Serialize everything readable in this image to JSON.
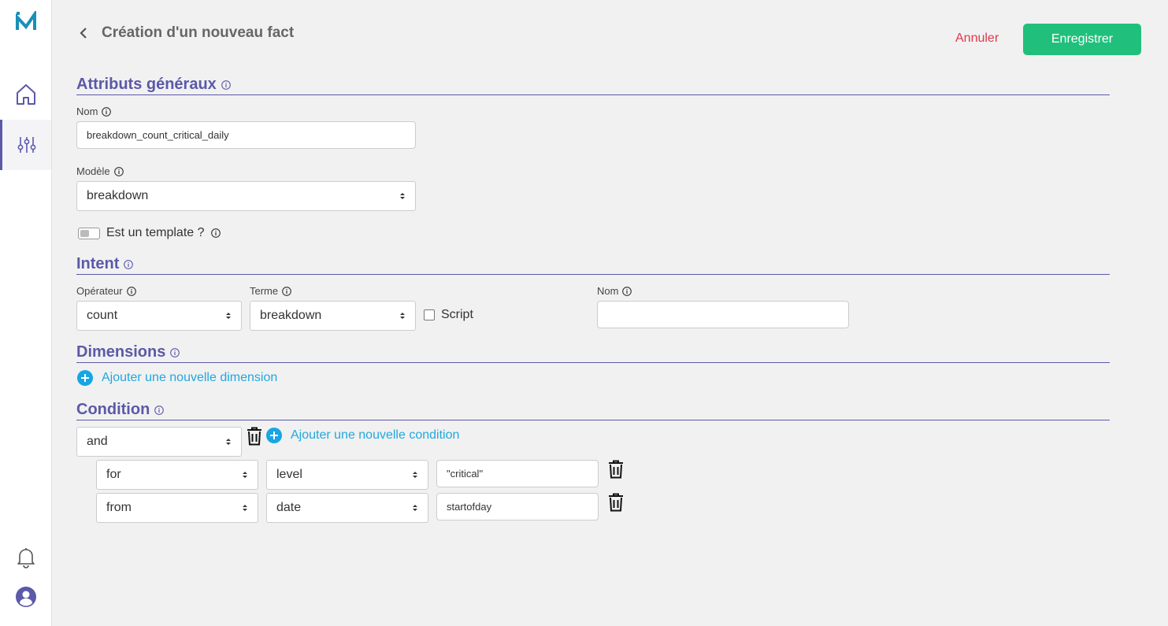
{
  "header": {
    "title": "Création d'un nouveau fact",
    "cancel_label": "Annuler",
    "save_label": "Enregistrer"
  },
  "general": {
    "title": "Attributs généraux",
    "name_label": "Nom",
    "name_value": "breakdown_count_critical_daily",
    "model_label": "Modèle",
    "model_value": "breakdown",
    "template_label": "Est un template ?",
    "template_enabled": false
  },
  "intent": {
    "title": "Intent",
    "operator_label": "Opérateur",
    "operator_value": "count",
    "term_label": "Terme",
    "term_value": "breakdown",
    "script_label": "Script",
    "script_checked": false,
    "name_label": "Nom",
    "name_value": ""
  },
  "dimensions": {
    "title": "Dimensions",
    "add_label": "Ajouter une nouvelle dimension"
  },
  "condition": {
    "title": "Condition",
    "logic_value": "and",
    "add_label": "Ajouter une nouvelle condition",
    "rows": [
      {
        "operator": "for",
        "field": "level",
        "value": "\"critical\""
      },
      {
        "operator": "from",
        "field": "date",
        "value": "startofday"
      }
    ]
  },
  "icons": {
    "logo": "m-logo",
    "nav": [
      "home-icon",
      "sliders-icon",
      "bell-icon",
      "user-icon"
    ]
  },
  "colors": {
    "accent": "#5b59a8",
    "primary_button": "#20c07c",
    "cancel": "#e0394b",
    "link": "#1fa8e0",
    "logo": "#1a8fb8"
  }
}
